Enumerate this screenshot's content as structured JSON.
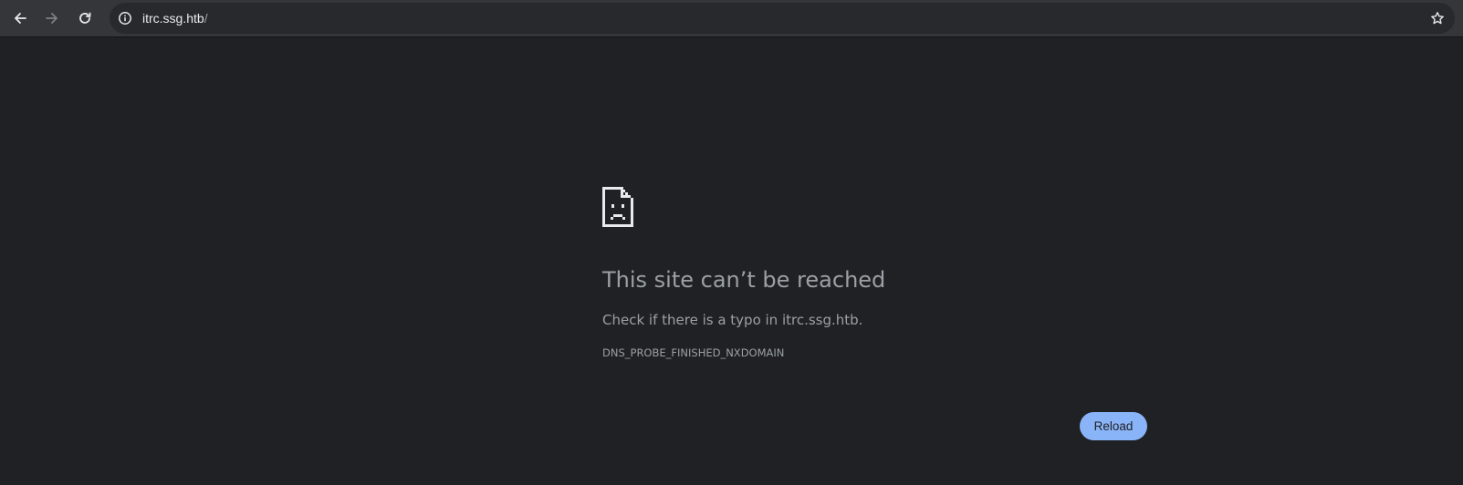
{
  "browser": {
    "back_icon": "arrow-left-icon",
    "forward_icon": "arrow-right-icon",
    "reload_icon": "reload-icon",
    "site_info_icon": "info-icon",
    "bookmark_icon": "star-icon",
    "address": {
      "host": "itrc.ssg.htb",
      "path": "/"
    }
  },
  "error_page": {
    "icon": "sad-document-icon",
    "title": "This site can’t be reached",
    "suggestion": "Check if there is a typo in itrc.ssg.htb.",
    "error_code": "DNS_PROBE_FINISHED_NXDOMAIN",
    "reload_label": "Reload"
  },
  "colors": {
    "background": "#202124",
    "toolbar": "#35363a",
    "text_secondary": "#9aa0a6",
    "accent": "#8ab4f8"
  }
}
